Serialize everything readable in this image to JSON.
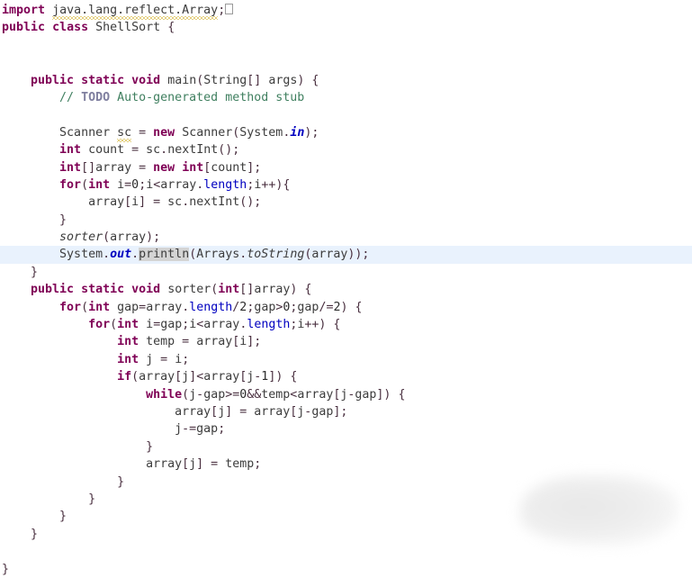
{
  "editor": {
    "language": "Java",
    "class_name": "ShellSort",
    "font_size_px": 13,
    "tab_width": 4,
    "colors": {
      "background": "#ffffff",
      "keyword": "#7f0055",
      "comment": "#3f7f5f",
      "todo_tag": "#7f7f9f",
      "field": "#0000c0",
      "identifier": "#3c3c3c",
      "current_line_highlight": "#e9f2fd",
      "occurrence_highlight": "#d4d4d4",
      "warning_squiggle": "#c8a200"
    },
    "markers": {
      "warning_underline_token": "sc",
      "warning_underline_import": "java.lang.reflect.Array",
      "occurrence_highlight_token": "println",
      "current_line_text": "System.out.println(Arrays.toString(array));"
    },
    "lines": [
      {
        "n": 1,
        "indent": 0,
        "hl": false,
        "tokens": [
          {
            "t": "import",
            "c": "kw"
          },
          {
            "t": " ",
            "c": "id"
          },
          {
            "t": "java.lang.reflect.Array",
            "c": "id warn"
          },
          {
            "t": ";",
            "c": "pun"
          },
          {
            "t": "",
            "c": "ctrlbox"
          }
        ]
      },
      {
        "n": 2,
        "indent": 0,
        "hl": false,
        "tokens": [
          {
            "t": "public",
            "c": "kw"
          },
          {
            "t": " ",
            "c": "id"
          },
          {
            "t": "class",
            "c": "kw"
          },
          {
            "t": " ",
            "c": "id"
          },
          {
            "t": "ShellSort",
            "c": "id"
          },
          {
            "t": " ",
            "c": "id"
          },
          {
            "t": "{",
            "c": "pun"
          }
        ]
      },
      {
        "n": 3,
        "indent": 0,
        "hl": false,
        "tokens": []
      },
      {
        "n": 4,
        "indent": 0,
        "hl": false,
        "tokens": []
      },
      {
        "n": 5,
        "indent": 1,
        "hl": false,
        "tokens": [
          {
            "t": "public",
            "c": "kw"
          },
          {
            "t": " ",
            "c": "id"
          },
          {
            "t": "static",
            "c": "kw"
          },
          {
            "t": " ",
            "c": "id"
          },
          {
            "t": "void",
            "c": "kw"
          },
          {
            "t": " ",
            "c": "id"
          },
          {
            "t": "main",
            "c": "id"
          },
          {
            "t": "(",
            "c": "pun"
          },
          {
            "t": "String",
            "c": "id"
          },
          {
            "t": "[] ",
            "c": "pun"
          },
          {
            "t": "args",
            "c": "id"
          },
          {
            "t": ") {",
            "c": "pun"
          }
        ]
      },
      {
        "n": 6,
        "indent": 2,
        "hl": false,
        "tokens": [
          {
            "t": "// ",
            "c": "cmt"
          },
          {
            "t": "TODO",
            "c": "todo"
          },
          {
            "t": " Auto-generated method stub",
            "c": "cmt"
          }
        ]
      },
      {
        "n": 7,
        "indent": 0,
        "hl": false,
        "tokens": []
      },
      {
        "n": 8,
        "indent": 2,
        "hl": false,
        "tokens": [
          {
            "t": "Scanner",
            "c": "id"
          },
          {
            "t": " ",
            "c": "id"
          },
          {
            "t": "sc",
            "c": "id warn"
          },
          {
            "t": " = ",
            "c": "pun"
          },
          {
            "t": "new",
            "c": "kw"
          },
          {
            "t": " ",
            "c": "id"
          },
          {
            "t": "Scanner",
            "c": "id"
          },
          {
            "t": "(",
            "c": "pun"
          },
          {
            "t": "System",
            "c": "id"
          },
          {
            "t": ".",
            "c": "pun"
          },
          {
            "t": "in",
            "c": "sfld"
          },
          {
            "t": ");",
            "c": "pun"
          }
        ]
      },
      {
        "n": 9,
        "indent": 2,
        "hl": false,
        "tokens": [
          {
            "t": "int",
            "c": "kw"
          },
          {
            "t": " ",
            "c": "id"
          },
          {
            "t": "count",
            "c": "id"
          },
          {
            "t": " = ",
            "c": "pun"
          },
          {
            "t": "sc",
            "c": "id"
          },
          {
            "t": ".",
            "c": "pun"
          },
          {
            "t": "nextInt",
            "c": "id"
          },
          {
            "t": "();",
            "c": "pun"
          }
        ]
      },
      {
        "n": 10,
        "indent": 2,
        "hl": false,
        "tokens": [
          {
            "t": "int",
            "c": "kw"
          },
          {
            "t": "[]",
            "c": "pun"
          },
          {
            "t": "array",
            "c": "id"
          },
          {
            "t": " = ",
            "c": "pun"
          },
          {
            "t": "new",
            "c": "kw"
          },
          {
            "t": " ",
            "c": "id"
          },
          {
            "t": "int",
            "c": "kw"
          },
          {
            "t": "[",
            "c": "pun"
          },
          {
            "t": "count",
            "c": "id"
          },
          {
            "t": "];",
            "c": "pun"
          }
        ]
      },
      {
        "n": 11,
        "indent": 2,
        "hl": false,
        "tokens": [
          {
            "t": "for",
            "c": "kw"
          },
          {
            "t": "(",
            "c": "pun"
          },
          {
            "t": "int",
            "c": "kw"
          },
          {
            "t": " ",
            "c": "id"
          },
          {
            "t": "i",
            "c": "id"
          },
          {
            "t": "=",
            "c": "pun"
          },
          {
            "t": "0",
            "c": "num"
          },
          {
            "t": ";",
            "c": "pun"
          },
          {
            "t": "i",
            "c": "id"
          },
          {
            "t": "<",
            "c": "pun"
          },
          {
            "t": "array",
            "c": "id"
          },
          {
            "t": ".",
            "c": "pun"
          },
          {
            "t": "length",
            "c": "fld"
          },
          {
            "t": ";",
            "c": "pun"
          },
          {
            "t": "i",
            "c": "id"
          },
          {
            "t": "++){",
            "c": "pun"
          }
        ]
      },
      {
        "n": 12,
        "indent": 3,
        "hl": false,
        "tokens": [
          {
            "t": "array",
            "c": "id"
          },
          {
            "t": "[",
            "c": "pun"
          },
          {
            "t": "i",
            "c": "id"
          },
          {
            "t": "] = ",
            "c": "pun"
          },
          {
            "t": "sc",
            "c": "id"
          },
          {
            "t": ".",
            "c": "pun"
          },
          {
            "t": "nextInt",
            "c": "id"
          },
          {
            "t": "();",
            "c": "pun"
          }
        ]
      },
      {
        "n": 13,
        "indent": 2,
        "hl": false,
        "tokens": [
          {
            "t": "}",
            "c": "pun"
          }
        ]
      },
      {
        "n": 14,
        "indent": 2,
        "hl": false,
        "tokens": [
          {
            "t": "sorter",
            "c": "stm"
          },
          {
            "t": "(",
            "c": "pun"
          },
          {
            "t": "array",
            "c": "id"
          },
          {
            "t": ");",
            "c": "pun"
          }
        ]
      },
      {
        "n": 15,
        "indent": 2,
        "hl": true,
        "tokens": [
          {
            "t": "System",
            "c": "id"
          },
          {
            "t": ".",
            "c": "pun"
          },
          {
            "t": "out",
            "c": "sfld"
          },
          {
            "t": ".",
            "c": "pun"
          },
          {
            "t": "println",
            "c": "id occ"
          },
          {
            "t": "(",
            "c": "pun"
          },
          {
            "t": "Arrays",
            "c": "id"
          },
          {
            "t": ".",
            "c": "pun"
          },
          {
            "t": "toString",
            "c": "stm"
          },
          {
            "t": "(",
            "c": "pun"
          },
          {
            "t": "array",
            "c": "id"
          },
          {
            "t": "));",
            "c": "pun"
          }
        ]
      },
      {
        "n": 16,
        "indent": 1,
        "hl": false,
        "tokens": [
          {
            "t": "}",
            "c": "pun"
          }
        ]
      },
      {
        "n": 17,
        "indent": 1,
        "hl": false,
        "tokens": [
          {
            "t": "public",
            "c": "kw"
          },
          {
            "t": " ",
            "c": "id"
          },
          {
            "t": "static",
            "c": "kw"
          },
          {
            "t": " ",
            "c": "id"
          },
          {
            "t": "void",
            "c": "kw"
          },
          {
            "t": " ",
            "c": "id"
          },
          {
            "t": "sorter",
            "c": "id"
          },
          {
            "t": "(",
            "c": "pun"
          },
          {
            "t": "int",
            "c": "kw"
          },
          {
            "t": "[]",
            "c": "pun"
          },
          {
            "t": "array",
            "c": "id"
          },
          {
            "t": ") {",
            "c": "pun"
          }
        ]
      },
      {
        "n": 18,
        "indent": 2,
        "hl": false,
        "tokens": [
          {
            "t": "for",
            "c": "kw"
          },
          {
            "t": "(",
            "c": "pun"
          },
          {
            "t": "int",
            "c": "kw"
          },
          {
            "t": " ",
            "c": "id"
          },
          {
            "t": "gap",
            "c": "id"
          },
          {
            "t": "=",
            "c": "pun"
          },
          {
            "t": "array",
            "c": "id"
          },
          {
            "t": ".",
            "c": "pun"
          },
          {
            "t": "length",
            "c": "fld"
          },
          {
            "t": "/",
            "c": "pun"
          },
          {
            "t": "2",
            "c": "num"
          },
          {
            "t": ";",
            "c": "pun"
          },
          {
            "t": "gap",
            "c": "id"
          },
          {
            "t": ">",
            "c": "pun"
          },
          {
            "t": "0",
            "c": "num"
          },
          {
            "t": ";",
            "c": "pun"
          },
          {
            "t": "gap",
            "c": "id"
          },
          {
            "t": "/=",
            "c": "pun"
          },
          {
            "t": "2",
            "c": "num"
          },
          {
            "t": ") {",
            "c": "pun"
          }
        ]
      },
      {
        "n": 19,
        "indent": 3,
        "hl": false,
        "tokens": [
          {
            "t": "for",
            "c": "kw"
          },
          {
            "t": "(",
            "c": "pun"
          },
          {
            "t": "int",
            "c": "kw"
          },
          {
            "t": " ",
            "c": "id"
          },
          {
            "t": "i",
            "c": "id"
          },
          {
            "t": "=",
            "c": "pun"
          },
          {
            "t": "gap",
            "c": "id"
          },
          {
            "t": ";",
            "c": "pun"
          },
          {
            "t": "i",
            "c": "id"
          },
          {
            "t": "<",
            "c": "pun"
          },
          {
            "t": "array",
            "c": "id"
          },
          {
            "t": ".",
            "c": "pun"
          },
          {
            "t": "length",
            "c": "fld"
          },
          {
            "t": ";",
            "c": "pun"
          },
          {
            "t": "i",
            "c": "id"
          },
          {
            "t": "++) {",
            "c": "pun"
          }
        ]
      },
      {
        "n": 20,
        "indent": 4,
        "hl": false,
        "tokens": [
          {
            "t": "int",
            "c": "kw"
          },
          {
            "t": " ",
            "c": "id"
          },
          {
            "t": "temp",
            "c": "id"
          },
          {
            "t": " = ",
            "c": "pun"
          },
          {
            "t": "array",
            "c": "id"
          },
          {
            "t": "[",
            "c": "pun"
          },
          {
            "t": "i",
            "c": "id"
          },
          {
            "t": "];",
            "c": "pun"
          }
        ]
      },
      {
        "n": 21,
        "indent": 4,
        "hl": false,
        "tokens": [
          {
            "t": "int",
            "c": "kw"
          },
          {
            "t": " ",
            "c": "id"
          },
          {
            "t": "j",
            "c": "id"
          },
          {
            "t": " = ",
            "c": "pun"
          },
          {
            "t": "i",
            "c": "id"
          },
          {
            "t": ";",
            "c": "pun"
          }
        ]
      },
      {
        "n": 22,
        "indent": 4,
        "hl": false,
        "tokens": [
          {
            "t": "if",
            "c": "kw"
          },
          {
            "t": "(",
            "c": "pun"
          },
          {
            "t": "array",
            "c": "id"
          },
          {
            "t": "[",
            "c": "pun"
          },
          {
            "t": "j",
            "c": "id"
          },
          {
            "t": "]",
            "c": "pun"
          },
          {
            "t": "<",
            "c": "pun"
          },
          {
            "t": "array",
            "c": "id"
          },
          {
            "t": "[",
            "c": "pun"
          },
          {
            "t": "j",
            "c": "id"
          },
          {
            "t": "-",
            "c": "pun"
          },
          {
            "t": "1",
            "c": "num"
          },
          {
            "t": "]) {",
            "c": "pun"
          }
        ]
      },
      {
        "n": 23,
        "indent": 5,
        "hl": false,
        "tokens": [
          {
            "t": "while",
            "c": "kw"
          },
          {
            "t": "(",
            "c": "pun"
          },
          {
            "t": "j",
            "c": "id"
          },
          {
            "t": "-",
            "c": "pun"
          },
          {
            "t": "gap",
            "c": "id"
          },
          {
            "t": ">=",
            "c": "pun"
          },
          {
            "t": "0",
            "c": "num"
          },
          {
            "t": "&&",
            "c": "pun"
          },
          {
            "t": "temp",
            "c": "id"
          },
          {
            "t": "<",
            "c": "pun"
          },
          {
            "t": "array",
            "c": "id"
          },
          {
            "t": "[",
            "c": "pun"
          },
          {
            "t": "j",
            "c": "id"
          },
          {
            "t": "-",
            "c": "pun"
          },
          {
            "t": "gap",
            "c": "id"
          },
          {
            "t": "]) {",
            "c": "pun"
          }
        ]
      },
      {
        "n": 24,
        "indent": 6,
        "hl": false,
        "tokens": [
          {
            "t": "array",
            "c": "id"
          },
          {
            "t": "[",
            "c": "pun"
          },
          {
            "t": "j",
            "c": "id"
          },
          {
            "t": "] = ",
            "c": "pun"
          },
          {
            "t": "array",
            "c": "id"
          },
          {
            "t": "[",
            "c": "pun"
          },
          {
            "t": "j",
            "c": "id"
          },
          {
            "t": "-",
            "c": "pun"
          },
          {
            "t": "gap",
            "c": "id"
          },
          {
            "t": "];",
            "c": "pun"
          }
        ]
      },
      {
        "n": 25,
        "indent": 6,
        "hl": false,
        "tokens": [
          {
            "t": "j",
            "c": "id"
          },
          {
            "t": "-=",
            "c": "pun"
          },
          {
            "t": "gap",
            "c": "id"
          },
          {
            "t": ";",
            "c": "pun"
          }
        ]
      },
      {
        "n": 26,
        "indent": 5,
        "hl": false,
        "tokens": [
          {
            "t": "}",
            "c": "pun"
          }
        ]
      },
      {
        "n": 27,
        "indent": 5,
        "hl": false,
        "tokens": [
          {
            "t": "array",
            "c": "id"
          },
          {
            "t": "[",
            "c": "pun"
          },
          {
            "t": "j",
            "c": "id"
          },
          {
            "t": "] = ",
            "c": "pun"
          },
          {
            "t": "temp",
            "c": "id"
          },
          {
            "t": ";",
            "c": "pun"
          }
        ]
      },
      {
        "n": 28,
        "indent": 4,
        "hl": false,
        "tokens": [
          {
            "t": "}",
            "c": "pun"
          }
        ]
      },
      {
        "n": 29,
        "indent": 3,
        "hl": false,
        "tokens": [
          {
            "t": "}",
            "c": "pun"
          }
        ]
      },
      {
        "n": 30,
        "indent": 2,
        "hl": false,
        "tokens": [
          {
            "t": "}",
            "c": "pun"
          }
        ]
      },
      {
        "n": 31,
        "indent": 1,
        "hl": false,
        "tokens": [
          {
            "t": "}",
            "c": "pun"
          }
        ]
      },
      {
        "n": 32,
        "indent": 0,
        "hl": false,
        "tokens": []
      },
      {
        "n": 33,
        "indent": 0,
        "hl": false,
        "tokens": [
          {
            "t": "}",
            "c": "pun"
          }
        ]
      }
    ]
  }
}
